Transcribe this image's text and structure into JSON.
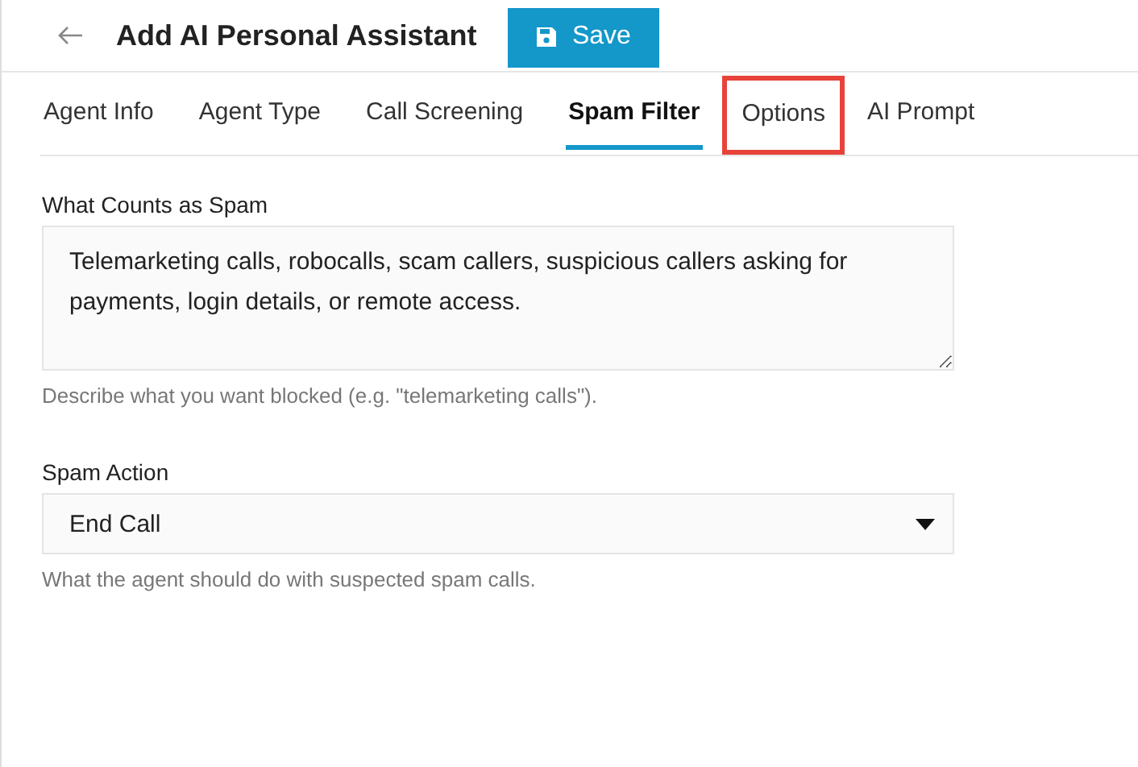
{
  "header": {
    "title": "Add AI Personal Assistant",
    "save_button": "Save"
  },
  "tabs": [
    {
      "label": "Agent Info",
      "selected": false,
      "highlighted": false
    },
    {
      "label": "Agent Type",
      "selected": false,
      "highlighted": false
    },
    {
      "label": "Call Screening",
      "selected": false,
      "highlighted": false
    },
    {
      "label": "Spam Filter",
      "selected": true,
      "highlighted": false
    },
    {
      "label": "Options",
      "selected": false,
      "highlighted": true
    },
    {
      "label": "AI Prompt",
      "selected": false,
      "highlighted": false
    }
  ],
  "spam_description": {
    "label": "What Counts as Spam",
    "value": "Telemarketing calls, robocalls, scam callers, suspicious callers asking for payments, login details, or remote access.",
    "help": "Describe what you want blocked (e.g. \"telemarketing calls\")."
  },
  "spam_action": {
    "label": "Spam Action",
    "value": "End Call",
    "help": "What the agent should do with suspected spam calls."
  }
}
